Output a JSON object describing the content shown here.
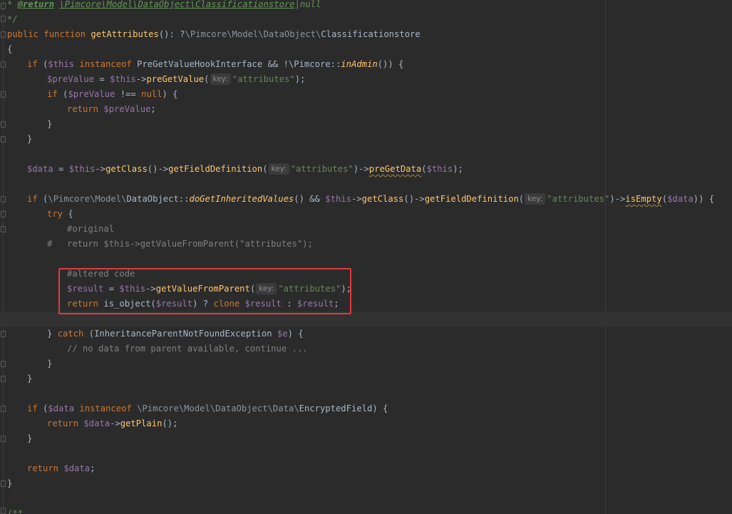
{
  "doc_return": {
    "star": "* ",
    "tag": "@return",
    "type": "\\Pimcore\\Model\\DataObject\\Classificationstore",
    "pipe": "|",
    "null": "null"
  },
  "doc_end": "*/",
  "signature": {
    "public": "public",
    "function": "function",
    "name": "getAttributes",
    "parens": "(): ",
    "qmark": "?",
    "ns": "\\Pimcore\\Model\\DataObject\\",
    "cls": "Classificationstore"
  },
  "open_brace": "{",
  "close_brace": "}",
  "hint_key": "key:",
  "str_attributes": "\"attributes\"",
  "line_if1": {
    "if": "if",
    "open": " (",
    "this": "$this",
    "instanceof": " instanceof ",
    "iface": "PreGetValueHookInterface",
    "and": " && !",
    "pimcore": "\\Pimcore::",
    "inadmin": "inAdmin",
    "close": "()) {"
  },
  "line_prevalue_assign": {
    "var": "$preValue",
    "eq": " = ",
    "this": "$this",
    "arrow": "->",
    "fn": "preGetValue",
    "paren": "(",
    "end": ");"
  },
  "line_if2": {
    "if": "if",
    "open": " (",
    "var": "$preValue",
    "neq": " !== ",
    "null": "null",
    "close": ") {"
  },
  "line_return_prevalue": {
    "ret": "return",
    "var": " $preValue",
    "semi": ";"
  },
  "line_data_assign": {
    "var": "$data",
    "eq": " = ",
    "this": "$this",
    "arrow1": "->",
    "getclass": "getClass",
    "call1": "()->",
    "getfield": "getFieldDefinition",
    "paren": "(",
    "arrow2": ")->",
    "pregetdata": "preGetData",
    "paren2": "(",
    "this2": "$this",
    "end": ");"
  },
  "line_if3": {
    "if": "if",
    "open": " (",
    "ns": "\\Pimcore\\Model\\",
    "dataobject": "DataObject::",
    "method": "doGetInheritedValues",
    "and": "() && ",
    "this": "$this",
    "arrow1": "->",
    "getclass": "getClass",
    "call1": "()->",
    "getfield": "getFieldDefinition",
    "paren": "(",
    "arrow2": ")->",
    "isempty": "isEmpty",
    "paren2": "(",
    "data": "$data",
    "close": ")) {"
  },
  "line_try": {
    "try": "try",
    "brace": " {"
  },
  "comment_original": "#original",
  "comment_hash": "#",
  "comment_return_parent": "return $this->getValueFromParent(\"attributes\");",
  "comment_altered": "#altered code",
  "line_result_assign": {
    "var": "$result",
    "eq": " = ",
    "this": "$this",
    "arrow": "->",
    "fn": "getValueFromParent",
    "paren": "(",
    "end": ");"
  },
  "line_return_result": {
    "ret": "return",
    "isobj": " is_object(",
    "var1": "$result",
    "tern": ") ? ",
    "clone": "clone",
    "var2": " $result",
    "colon": " : ",
    "var3": "$result",
    "semi": ";"
  },
  "line_catch": {
    "brace": "} ",
    "catch": "catch",
    "open": " (",
    "exc": "InheritanceParentNotFoundException",
    "var": " $e",
    "close": ") {"
  },
  "comment_no_data": "// no data from parent available, continue ...",
  "line_if4": {
    "if": "if",
    "open": " (",
    "var": "$data",
    "instanceof": " instanceof ",
    "ns": "\\Pimcore\\Model\\DataObject\\Data\\",
    "cls": "EncryptedField",
    "close": ") {"
  },
  "line_return_plain": {
    "ret": "return",
    "var": " $data",
    "arrow": "->",
    "fn": "getPlain",
    "end": "();"
  },
  "line_return_data": {
    "ret": "return",
    "var": " $data",
    "semi": ";"
  },
  "doc_next": "/**"
}
